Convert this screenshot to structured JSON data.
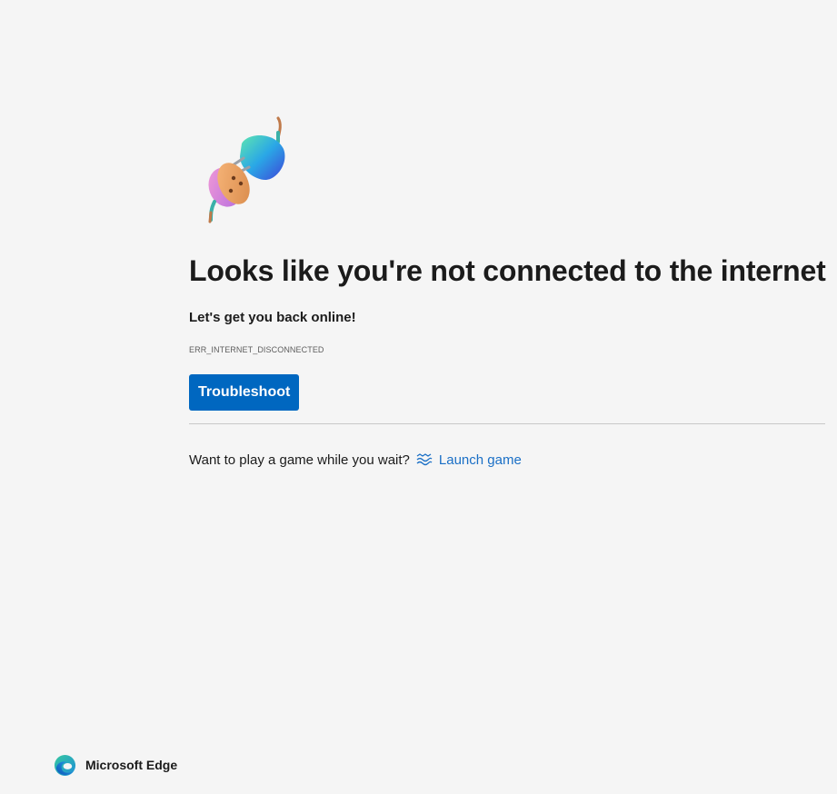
{
  "main": {
    "headline": "Looks like you're not connected to the internet",
    "subhead": "Let's get you back online!",
    "error_code": "ERR_INTERNET_DISCONNECTED",
    "troubleshoot_label": "Troubleshoot"
  },
  "game": {
    "prompt": "Want to play a game while you wait?",
    "link_label": "Launch game",
    "icon": "surf-waves-icon"
  },
  "footer": {
    "brand": "Microsoft Edge",
    "logo_icon": "edge-logo-icon"
  },
  "colors": {
    "background": "#f5f5f5",
    "accent_button": "#0067c0",
    "link": "#1a6fc6",
    "text": "#1b1b1b"
  }
}
